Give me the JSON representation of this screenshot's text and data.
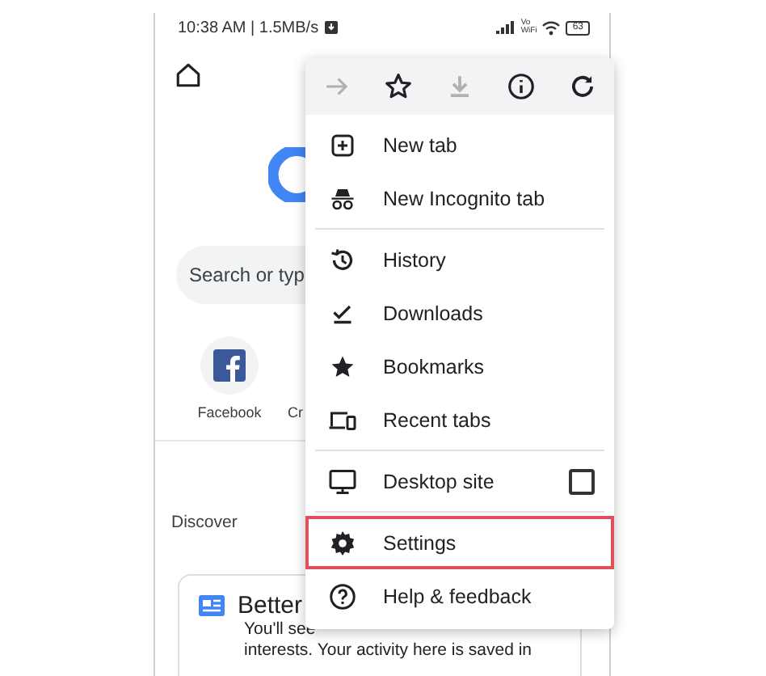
{
  "status_bar": {
    "time": "10:38 AM | 1.5MB/s",
    "network_label": "Vo\nWiFi",
    "battery": "63"
  },
  "search": {
    "placeholder": "Search or typ"
  },
  "shortcuts": [
    {
      "label": "Facebook",
      "kind": "facebook"
    },
    {
      "label": "Cr",
      "kind": "blank"
    }
  ],
  "discover": {
    "title": "Discover"
  },
  "card": {
    "title": "Better",
    "lines": [
      "You'll see",
      "interests. Your activity here is saved in"
    ]
  },
  "menu": {
    "toolbar": [
      {
        "kind": "forward",
        "disabled": true
      },
      {
        "kind": "star",
        "disabled": false
      },
      {
        "kind": "download",
        "disabled": true
      },
      {
        "kind": "info",
        "disabled": false
      },
      {
        "kind": "refresh",
        "disabled": false
      }
    ],
    "sections": [
      [
        {
          "label": "New tab",
          "kind": "item",
          "highlighted": false
        },
        {
          "label": "New Incognito tab",
          "kind": "item",
          "highlighted": false
        }
      ],
      [
        {
          "label": "History",
          "kind": "item",
          "highlighted": false
        },
        {
          "label": "Downloads",
          "kind": "item",
          "highlighted": false
        },
        {
          "label": "Bookmarks",
          "kind": "item",
          "highlighted": false
        },
        {
          "label": "Recent tabs",
          "kind": "item",
          "highlighted": false
        }
      ],
      [
        {
          "label": "Desktop site",
          "kind": "checkbox",
          "checked": false,
          "highlighted": false
        }
      ],
      [
        {
          "label": "Settings",
          "kind": "item",
          "highlighted": true
        },
        {
          "label": "Help & feedback",
          "kind": "item",
          "highlighted": false
        }
      ]
    ]
  }
}
